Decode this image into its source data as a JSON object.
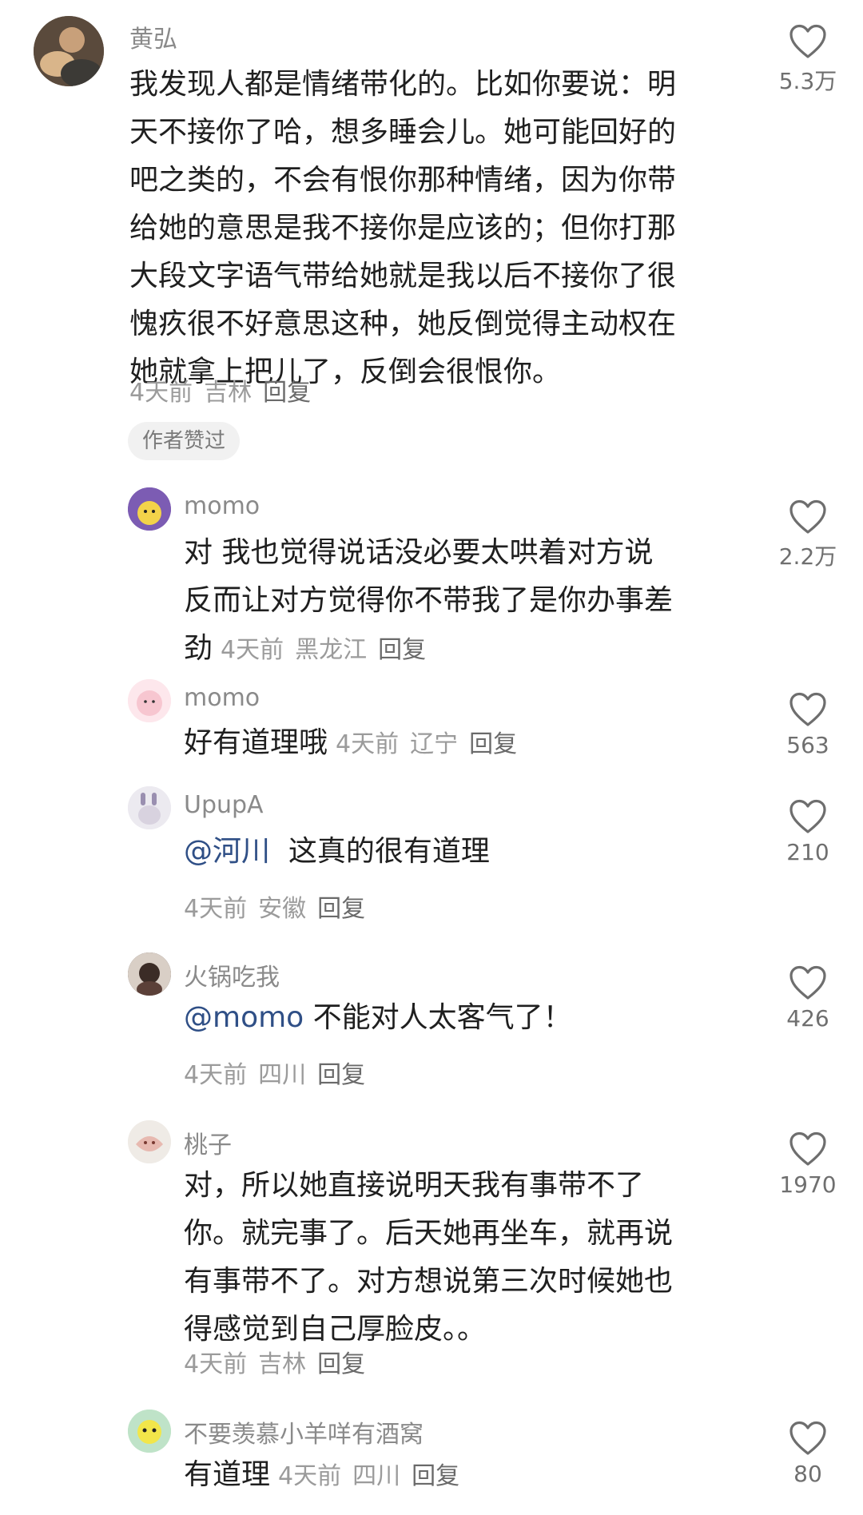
{
  "comments": [
    {
      "user": "黄弘",
      "lines": [
        "我发现人都是情绪带化的。比如你要说：明",
        "天不接你了哈，想多睡会儿。她可能回好的",
        "吧之类的，不会有恨你那种情绪，因为你带",
        "给她的意思是我不接你是应该的；但你打那",
        "大段文字语气带给她就是我以后不接你了很",
        "愧疚很不好意思这种，她反倒觉得主动权在",
        "她就拿上把儿了，反倒会很恨你。"
      ],
      "time": "4天前",
      "location": "吉林",
      "reply": "回复",
      "likes": "5.3万",
      "badge": "作者赞过"
    },
    {
      "user": "momo",
      "lines": [
        "对  我也觉得说话没必要太哄着对方说",
        "反而让对方觉得你不带我了是你办事差",
        "劲"
      ],
      "time": "4天前",
      "location": "黑龙江",
      "reply": "回复",
      "likes": "2.2万"
    },
    {
      "user": "momo",
      "lines": [
        "好有道理哦"
      ],
      "time": "4天前",
      "location": "辽宁",
      "reply": "回复",
      "likes": "563"
    },
    {
      "user": "UpupA",
      "mention": "@河川",
      "lines": [
        "  这真的很有道理"
      ],
      "time": "4天前",
      "location": "安徽",
      "reply": "回复",
      "likes": "210"
    },
    {
      "user": "火锅吃我",
      "mention": "@momo",
      "lines": [
        " 不能对人太客气了！"
      ],
      "time": "4天前",
      "location": "四川",
      "reply": "回复",
      "likes": "426"
    },
    {
      "user": "桃子",
      "lines": [
        "对，所以她直接说明天我有事带不了",
        "你。就完事了。后天她再坐车，就再说",
        "有事带不了。对方想说第三次时候她也",
        "得感觉到自己厚脸皮。。"
      ],
      "time": "4天前",
      "location": "吉林",
      "reply": "回复",
      "likes": "1970"
    },
    {
      "user": "不要羡慕小羊咩有酒窝",
      "lines": [
        "有道理"
      ],
      "time": "4天前",
      "location": "四川",
      "reply": "回复",
      "likes": "80"
    }
  ],
  "icons": {
    "like": "heart-outline-icon"
  },
  "colors": {
    "text": "#1f1f1f",
    "muted": "#9b9b9b",
    "mention": "#2f4f86"
  }
}
